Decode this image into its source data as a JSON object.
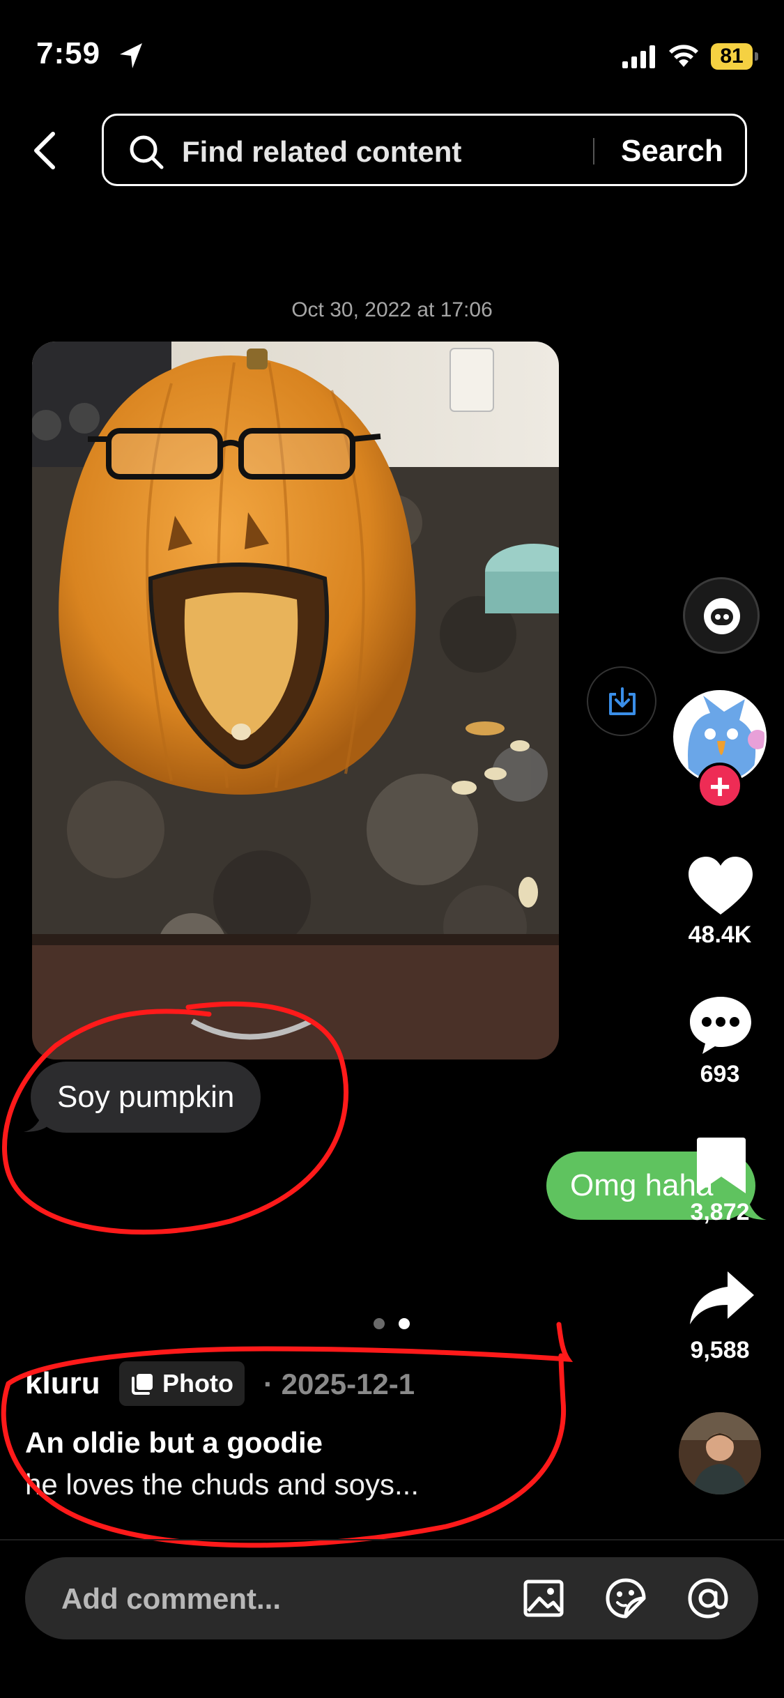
{
  "status_bar": {
    "time": "7:59",
    "battery": "81",
    "battery_color": "#f5d142"
  },
  "top_bar": {
    "search_placeholder": "Find related content",
    "search_button": "Search"
  },
  "message_timestamp": "Oct 30, 2022 at 17:06",
  "chat": {
    "incoming": "Soy pumpkin",
    "outgoing": "Omg haha",
    "incoming_color": "#2c2c2e",
    "outgoing_color": "#5fc35f"
  },
  "actions": {
    "likes": "48.4K",
    "comments": "693",
    "saves": "3,872",
    "shares": "9,588",
    "accent": "#ee2c55"
  },
  "pager": {
    "total": 2,
    "active": 2
  },
  "post": {
    "author": "kluru",
    "badge": "Photo",
    "date": "· 2025-12-1",
    "title": "An oldie but a goodie",
    "description": "he loves the chuds and soys..."
  },
  "comment_bar": {
    "placeholder": "Add comment..."
  },
  "annotation_color": "#ff1a1a"
}
